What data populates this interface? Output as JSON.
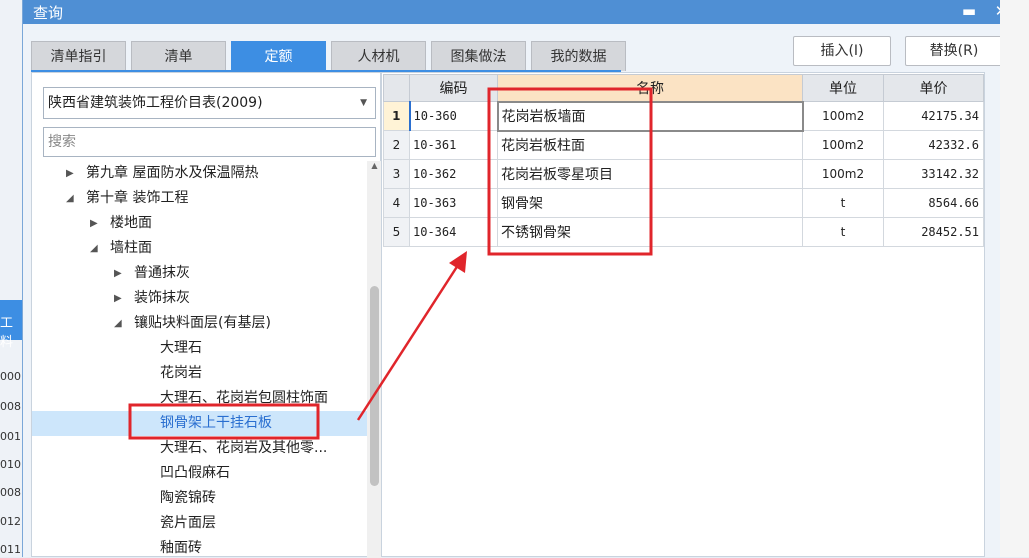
{
  "background": {
    "left_tab": "工料",
    "row_fragments": [
      "000",
      "008",
      "001",
      "010",
      "008",
      "012",
      "011"
    ]
  },
  "dialog": {
    "title": "查询",
    "minimize_label": "▬",
    "close_label": "✕"
  },
  "tabs": [
    {
      "label": "清单指引"
    },
    {
      "label": "清单"
    },
    {
      "label": "定额",
      "active": true
    },
    {
      "label": "人材机"
    },
    {
      "label": "图集做法"
    },
    {
      "label": "我的数据"
    }
  ],
  "buttons": {
    "insert_label": "插入(I)",
    "replace_label": "替换(R)"
  },
  "left": {
    "library_value": "陕西省建筑装饰工程价目表(2009)",
    "search_placeholder": "搜索",
    "tree": [
      {
        "label": "第九章 屋面防水及保温隔热",
        "toggle": "▶"
      },
      {
        "label": "第十章 装饰工程",
        "toggle": "◢"
      },
      {
        "label": "楼地面",
        "toggle": "▶"
      },
      {
        "label": "墙柱面",
        "toggle": "◢"
      },
      {
        "label": "普通抹灰",
        "toggle": "▶"
      },
      {
        "label": "装饰抹灰",
        "toggle": "▶"
      },
      {
        "label": "镶贴块料面层(有基层)",
        "toggle": "◢"
      },
      {
        "label": "大理石",
        "toggle": ""
      },
      {
        "label": "花岗岩",
        "toggle": ""
      },
      {
        "label": "大理石、花岗岩包圆柱饰面",
        "toggle": ""
      },
      {
        "label": "钢骨架上干挂石板",
        "toggle": "",
        "selected": true
      },
      {
        "label": "大理石、花岗岩及其他零...",
        "toggle": ""
      },
      {
        "label": "凹凸假麻石",
        "toggle": ""
      },
      {
        "label": "陶瓷锦砖",
        "toggle": ""
      },
      {
        "label": "瓷片面层",
        "toggle": ""
      },
      {
        "label": "釉面砖",
        "toggle": ""
      }
    ]
  },
  "grid": {
    "headers": {
      "code": "编码",
      "name": "名称",
      "unit": "单位",
      "price": "单价"
    },
    "rows": [
      {
        "n": "1",
        "code": "10-360",
        "name": "花岗岩板墙面",
        "unit": "100m2",
        "price": "42175.34"
      },
      {
        "n": "2",
        "code": "10-361",
        "name": "花岗岩板柱面",
        "unit": "100m2",
        "price": "42332.6"
      },
      {
        "n": "3",
        "code": "10-362",
        "name": "花岗岩板零星项目",
        "unit": "100m2",
        "price": "33142.32"
      },
      {
        "n": "4",
        "code": "10-363",
        "name": "钢骨架",
        "unit": "t",
        "price": "8564.66"
      },
      {
        "n": "5",
        "code": "10-364",
        "name": "不锈钢骨架",
        "unit": "t",
        "price": "28452.51"
      }
    ]
  },
  "annotation": {
    "color": "#e0252b"
  }
}
